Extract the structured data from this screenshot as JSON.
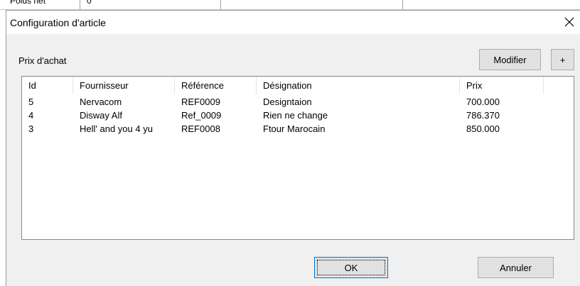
{
  "background": {
    "label": "Poids net",
    "value": "0"
  },
  "dialog": {
    "title": "Configuration d'article",
    "section_label": "Prix d'achat",
    "buttons": {
      "modifier": "Modifier",
      "add": "+",
      "ok": "OK",
      "cancel": "Annuler"
    }
  },
  "table": {
    "columns": [
      "Id",
      "Fournisseur",
      "Référence",
      "Désignation",
      "Prix"
    ],
    "rows": [
      [
        "5",
        "Nervacom",
        "REF0009",
        "Designtaion",
        "700.000"
      ],
      [
        "4",
        "Disway Alf",
        "Ref_0009",
        "Rien ne change",
        "786.370"
      ],
      [
        "3",
        "Hell' and you 4 yu",
        "REF0008",
        "Ftour Marocain",
        "850.000"
      ]
    ]
  },
  "icons": {
    "close": "close-icon"
  },
  "colors": {
    "dialog_bg": "#f0f0f0",
    "button_bg": "#e1e1e1",
    "focus_border": "#0078d7"
  }
}
